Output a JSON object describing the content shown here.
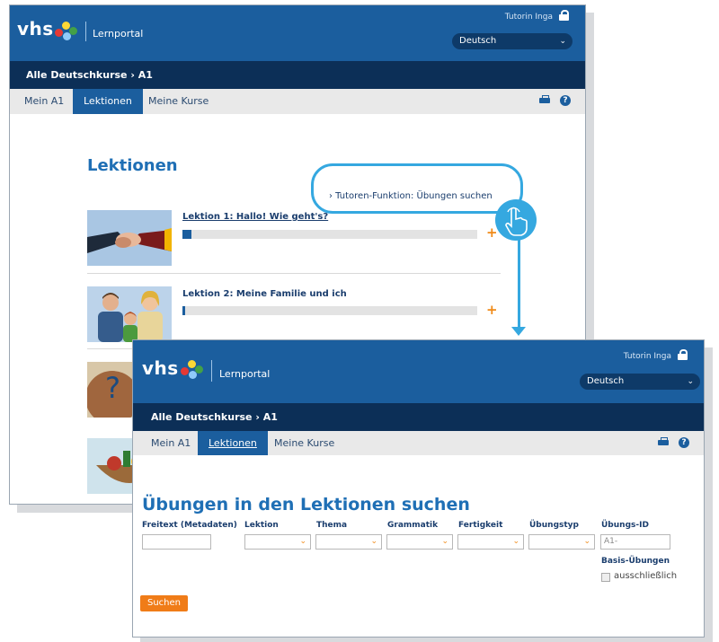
{
  "colors": {
    "brand_blue": "#1b5e9e",
    "nav_dark": "#0c2f57",
    "accent_orange": "#f07c18",
    "callout_blue": "#35a8e0"
  },
  "header": {
    "logo": "vhs",
    "portal": "Lernportal",
    "user": "Tutorin Inga",
    "lang": "Deutsch"
  },
  "breadcrumb": {
    "text": "Alle Deutschkurse  ›  A1"
  },
  "tabs": [
    {
      "label": "Mein A1"
    },
    {
      "label": "Lektionen"
    },
    {
      "label": "Meine Kurse"
    }
  ],
  "lessons_page": {
    "title": "Lektionen",
    "tutor_link": "› Tutoren-Funktion: Übungen suchen",
    "lessons": [
      {
        "title": "Lektion 1: Hallo! Wie geht's?",
        "progress": 0.03
      },
      {
        "title": "Lektion 2: Meine Familie und ich",
        "progress": 0.005
      }
    ]
  },
  "search_page": {
    "title": "Übungen in den Lektionen suchen",
    "labels": {
      "freitext": "Freitext (Metadaten)",
      "lektion": "Lektion",
      "thema": "Thema",
      "grammatik": "Grammatik",
      "fertigkeit": "Fertigkeit",
      "uebungstyp": "Übungstyp",
      "uebungs_id": "Übungs-ID"
    },
    "uebungs_id_placeholder": "A1-",
    "basis_label": "Basis-Übungen",
    "basis_checkbox": "ausschließlich",
    "submit": "Suchen"
  }
}
